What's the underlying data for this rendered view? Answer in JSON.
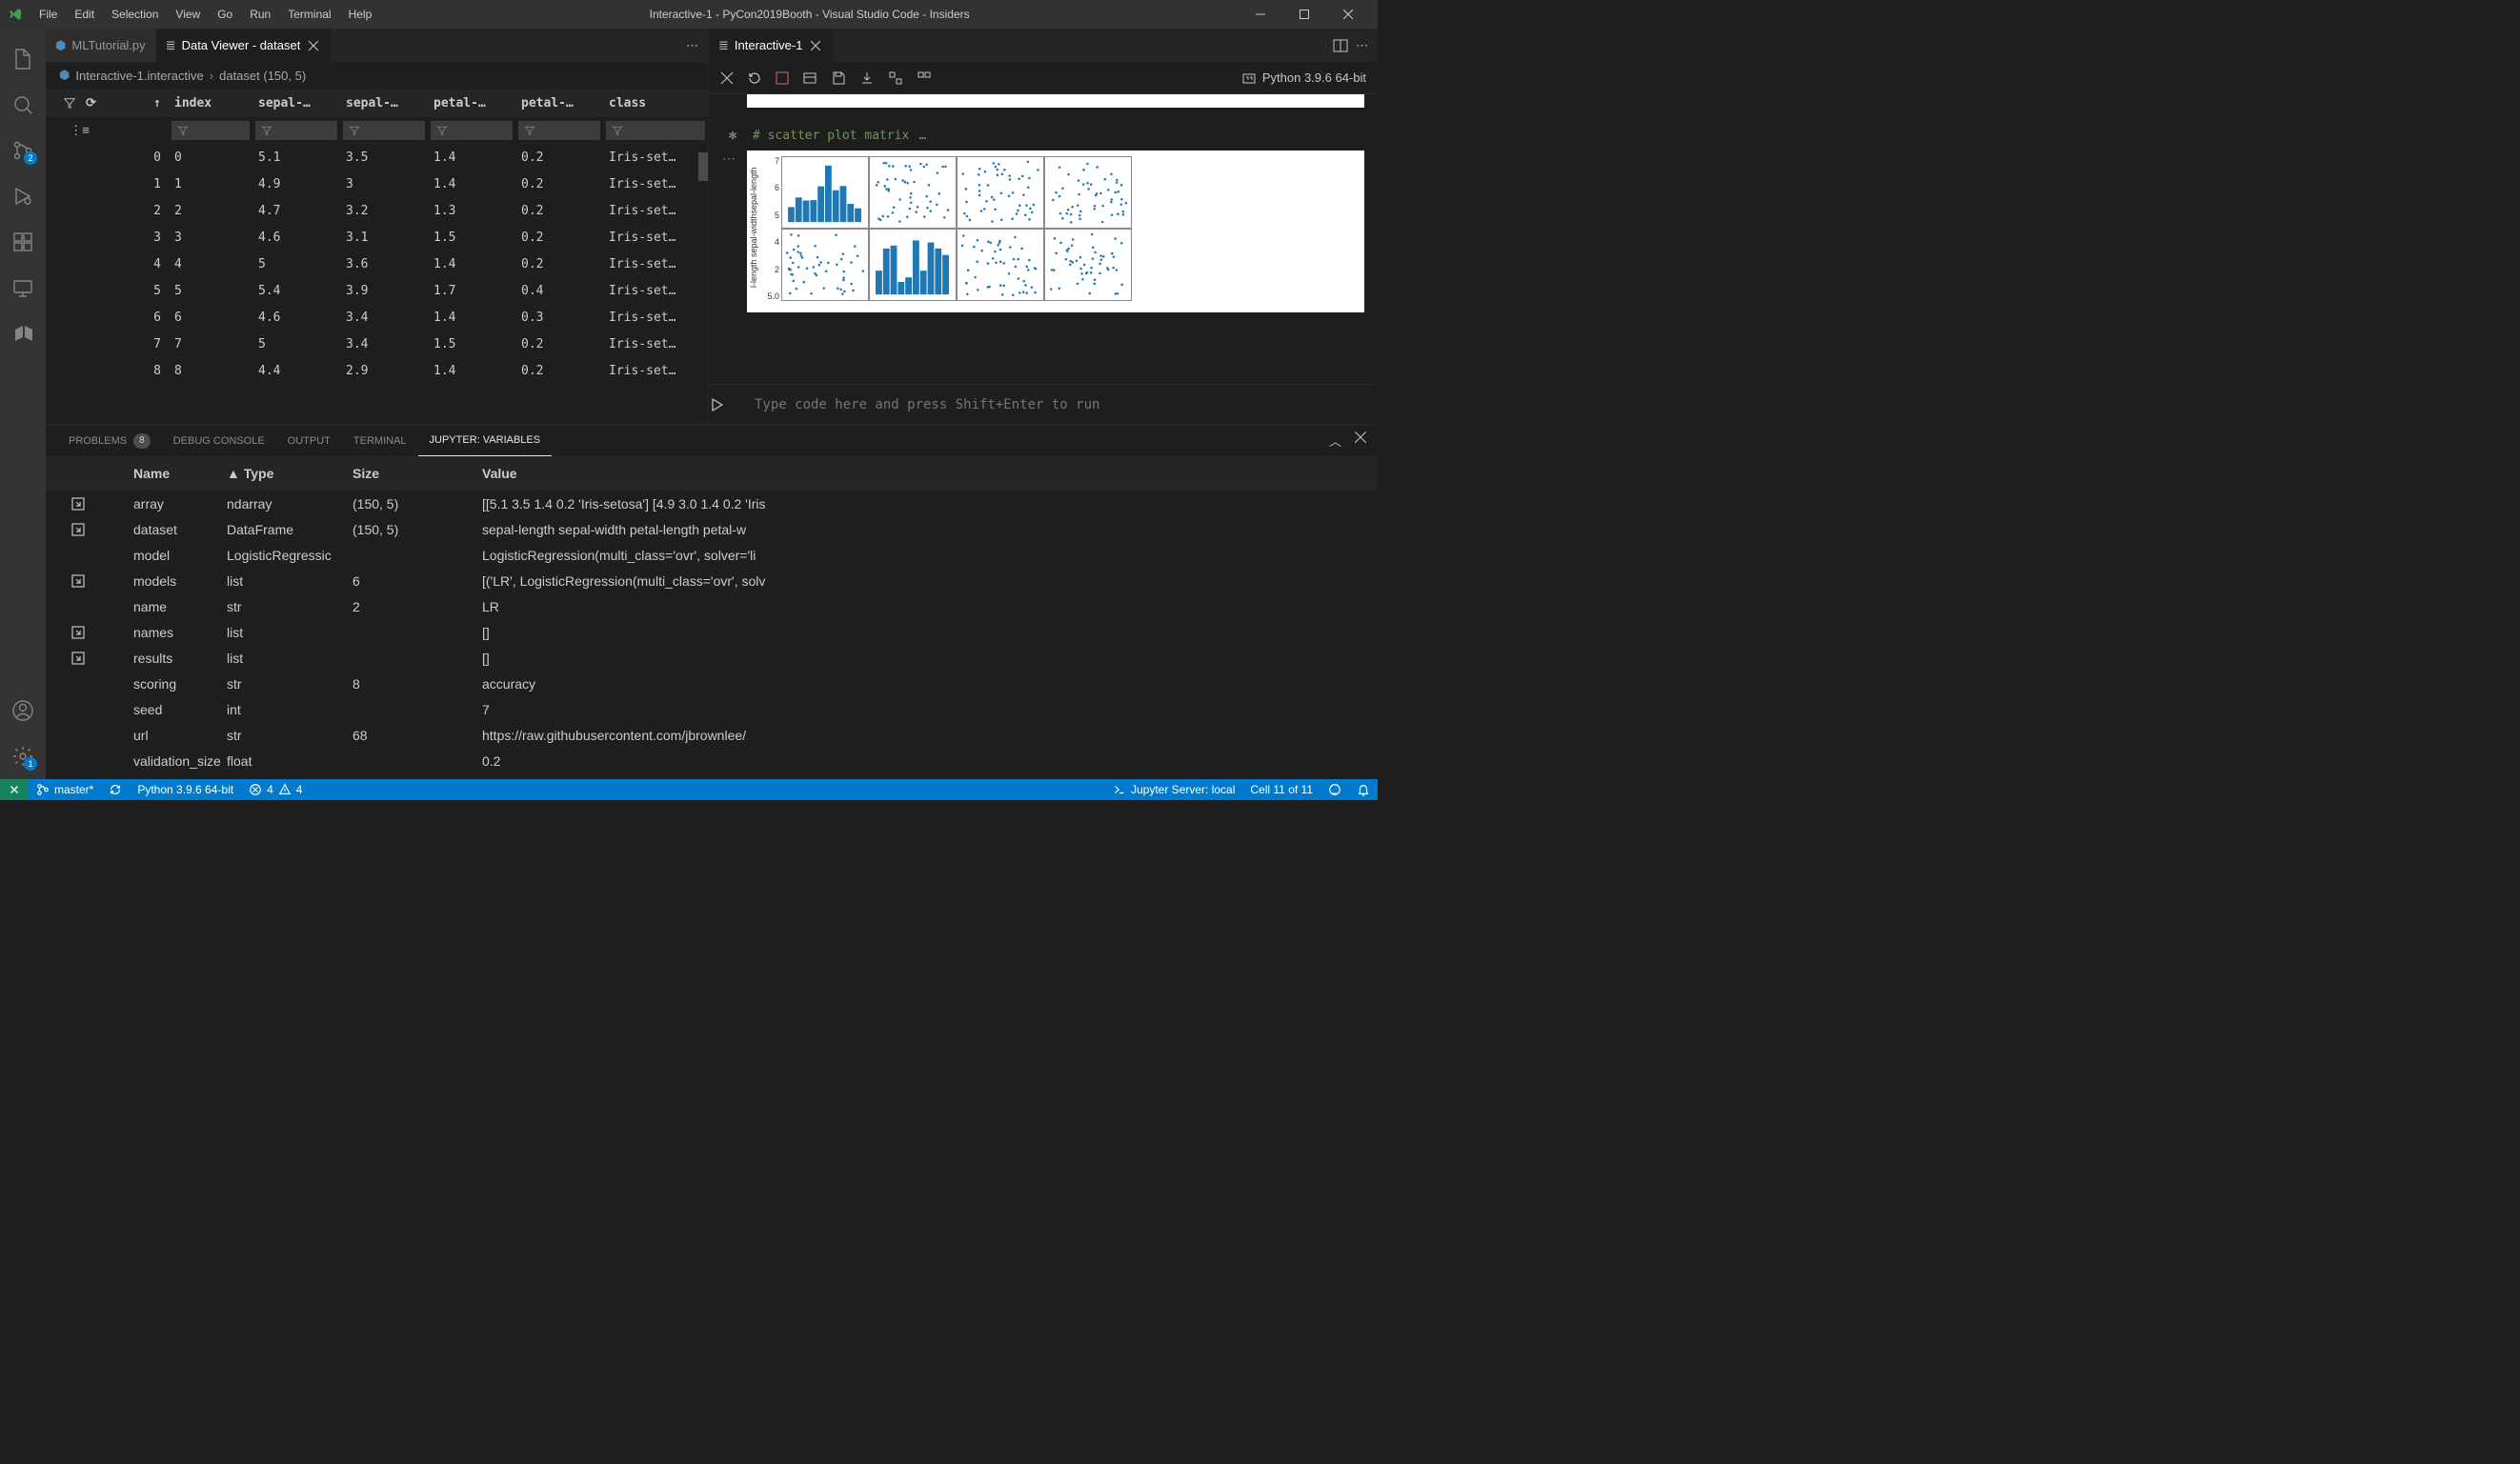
{
  "window": {
    "title": "Interactive-1 - PyCon2019Booth - Visual Studio Code - Insiders"
  },
  "menu": [
    "File",
    "Edit",
    "Selection",
    "View",
    "Go",
    "Run",
    "Terminal",
    "Help"
  ],
  "activitybar": {
    "scm_badge": "2",
    "settings_badge": "1"
  },
  "editor_left": {
    "tabs": [
      {
        "icon": "python",
        "label": "MLTutorial.py",
        "active": false
      },
      {
        "icon": "dataviewer",
        "label": "Data Viewer - dataset",
        "active": true
      }
    ],
    "breadcrumb": [
      "Interactive-1.interactive",
      "dataset (150, 5)"
    ],
    "columns": [
      "index",
      "sepal-…",
      "sepal-…",
      "petal-…",
      "petal-…",
      "class"
    ],
    "rows": [
      {
        "i": "0",
        "index": "0",
        "c": [
          "5.1",
          "3.5",
          "1.4",
          "0.2",
          "Iris-set…"
        ]
      },
      {
        "i": "1",
        "index": "1",
        "c": [
          "4.9",
          "3",
          "1.4",
          "0.2",
          "Iris-set…"
        ]
      },
      {
        "i": "2",
        "index": "2",
        "c": [
          "4.7",
          "3.2",
          "1.3",
          "0.2",
          "Iris-set…"
        ]
      },
      {
        "i": "3",
        "index": "3",
        "c": [
          "4.6",
          "3.1",
          "1.5",
          "0.2",
          "Iris-set…"
        ]
      },
      {
        "i": "4",
        "index": "4",
        "c": [
          "5",
          "3.6",
          "1.4",
          "0.2",
          "Iris-set…"
        ]
      },
      {
        "i": "5",
        "index": "5",
        "c": [
          "5.4",
          "3.9",
          "1.7",
          "0.4",
          "Iris-set…"
        ]
      },
      {
        "i": "6",
        "index": "6",
        "c": [
          "4.6",
          "3.4",
          "1.4",
          "0.3",
          "Iris-set…"
        ]
      },
      {
        "i": "7",
        "index": "7",
        "c": [
          "5",
          "3.4",
          "1.5",
          "0.2",
          "Iris-set…"
        ]
      },
      {
        "i": "8",
        "index": "8",
        "c": [
          "4.4",
          "2.9",
          "1.4",
          "0.2",
          "Iris-set…"
        ]
      }
    ]
  },
  "editor_right": {
    "tab": "Interactive-1",
    "python_env": "Python 3.9.6 64-bit",
    "cell_comment": "# scatter plot matrix",
    "input_placeholder": "Type code here and press Shift+Enter to run",
    "plot_ylabel_combined": "sepal-length sepal-width petal-length",
    "plot_ticks": [
      "7",
      "6",
      "5",
      "4",
      "2",
      "5.0"
    ]
  },
  "panel": {
    "tabs": [
      {
        "label": "PROBLEMS",
        "badge": "8"
      },
      {
        "label": "DEBUG CONSOLE"
      },
      {
        "label": "OUTPUT"
      },
      {
        "label": "TERMINAL"
      },
      {
        "label": "JUPYTER: VARIABLES",
        "active": true
      }
    ],
    "header": {
      "name": "Name",
      "type": "Type",
      "type_sort_prefix": "▲ ",
      "size": "Size",
      "value": "Value"
    },
    "vars": [
      {
        "expand": true,
        "name": "array",
        "type": "ndarray",
        "size": "(150, 5)",
        "value": "[[5.1 3.5 1.4 0.2 'Iris-setosa'] [4.9 3.0 1.4 0.2 'Iris"
      },
      {
        "expand": true,
        "name": "dataset",
        "type": "DataFrame",
        "size": "(150, 5)",
        "value": "sepal-length sepal-width petal-length petal-w"
      },
      {
        "expand": false,
        "name": "model",
        "type": "LogisticRegressic",
        "size": "",
        "value": "LogisticRegression(multi_class='ovr', solver='li"
      },
      {
        "expand": true,
        "name": "models",
        "type": "list",
        "size": "6",
        "value": "[('LR', LogisticRegression(multi_class='ovr', solv"
      },
      {
        "expand": false,
        "name": "name",
        "type": "str",
        "size": "2",
        "value": "LR"
      },
      {
        "expand": true,
        "name": "names",
        "type": "list",
        "size": "",
        "value": "[]"
      },
      {
        "expand": true,
        "name": "results",
        "type": "list",
        "size": "",
        "value": "[]"
      },
      {
        "expand": false,
        "name": "scoring",
        "type": "str",
        "size": "8",
        "value": "accuracy"
      },
      {
        "expand": false,
        "name": "seed",
        "type": "int",
        "size": "",
        "value": "7"
      },
      {
        "expand": false,
        "name": "url",
        "type": "str",
        "size": "68",
        "value": "https://raw.githubusercontent.com/jbrownlee/"
      },
      {
        "expand": false,
        "name": "validation_size",
        "type": "float",
        "size": "",
        "value": "0.2"
      }
    ]
  },
  "statusbar": {
    "branch": "master*",
    "python": "Python 3.9.6 64-bit",
    "errors": "4",
    "warnings": "4",
    "jupyter": "Jupyter Server: local",
    "cell": "Cell 11 of 11"
  }
}
